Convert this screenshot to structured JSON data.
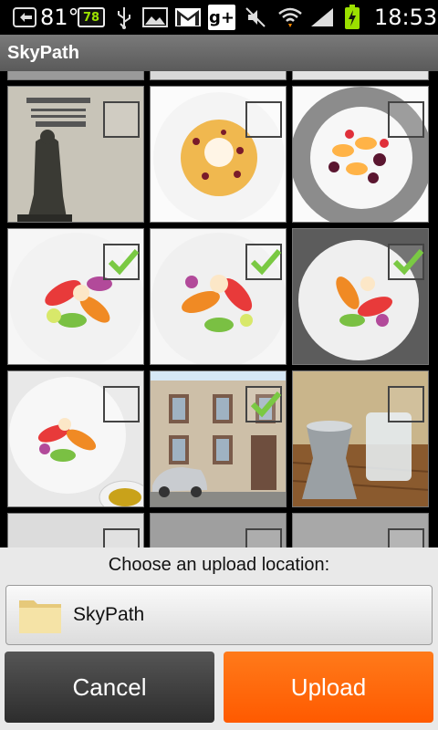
{
  "status_bar": {
    "temperature": "81°",
    "battery_badge": "78",
    "time": "18:53",
    "icons": [
      "notification-icon",
      "battery-badge-icon",
      "usb-icon",
      "gallery-icon",
      "gmail-icon",
      "google-plus-icon",
      "mute-icon",
      "wifi-icon",
      "signal-icon",
      "battery-charging-icon"
    ]
  },
  "app": {
    "title": "SkyPath"
  },
  "photos": [
    {
      "subject": "statue-in-front-of-engraved-wall",
      "checked": false
    },
    {
      "subject": "dessert-plate",
      "checked": false
    },
    {
      "subject": "fruit-plate-gray-rim",
      "checked": false
    },
    {
      "subject": "salad-plate",
      "checked": true
    },
    {
      "subject": "salad-plate",
      "checked": true
    },
    {
      "subject": "salad-plate",
      "checked": true
    },
    {
      "subject": "salad-plate-with-oil",
      "checked": false
    },
    {
      "subject": "building-with-car",
      "checked": true
    },
    {
      "subject": "silver-pitcher-on-table",
      "checked": false
    }
  ],
  "upload": {
    "prompt": "Choose an upload location:",
    "location_name": "SkyPath",
    "cancel_label": "Cancel",
    "upload_label": "Upload"
  },
  "colors": {
    "accent": "#ff6600",
    "checkmark": "#7ac943"
  }
}
